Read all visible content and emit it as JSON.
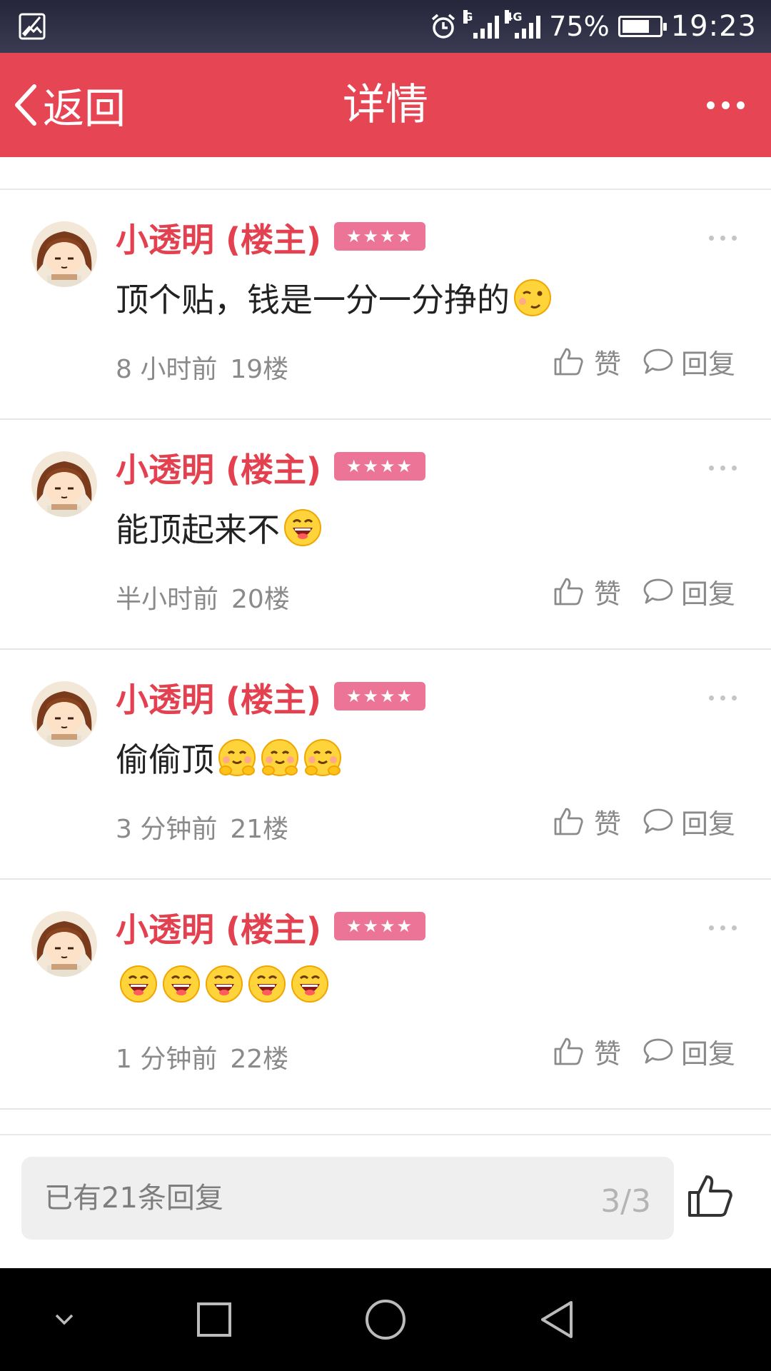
{
  "status_bar": {
    "network_label_1": "G",
    "network_label_2": "4G",
    "battery_percent": "75%",
    "battery_level": 0.75,
    "time": "19:23"
  },
  "header": {
    "back_label": "返回",
    "title": "详情"
  },
  "posts": [
    {
      "username": "小透明 (楼主)",
      "level": "★★★★",
      "text": "顶个贴，钱是一分一分挣的",
      "emojis": [
        "wink-emoji"
      ],
      "time": "8 小时前",
      "floor": "19楼",
      "like_label": "赞",
      "reply_label": "回复"
    },
    {
      "username": "小透明 (楼主)",
      "level": "★★★★",
      "text": "能顶起来不",
      "emojis": [
        "laugh-emoji"
      ],
      "time": "半小时前",
      "floor": "20楼",
      "like_label": "赞",
      "reply_label": "回复"
    },
    {
      "username": "小透明 (楼主)",
      "level": "★★★★",
      "text": "偷偷顶",
      "emojis": [
        "hug-emoji",
        "hug-emoji",
        "hug-emoji"
      ],
      "time": "3 分钟前",
      "floor": "21楼",
      "like_label": "赞",
      "reply_label": "回复"
    },
    {
      "username": "小透明 (楼主)",
      "level": "★★★★",
      "text": "",
      "emojis": [
        "laugh-emoji",
        "laugh-emoji",
        "laugh-emoji",
        "laugh-emoji",
        "laugh-emoji"
      ],
      "time": "1 分钟前",
      "floor": "22楼",
      "like_label": "赞",
      "reply_label": "回复"
    }
  ],
  "reply_bar": {
    "placeholder": "已有21条回复",
    "page_indicator": "3/3"
  },
  "colors": {
    "header_bg": "#e64553",
    "username": "#e3414f",
    "level_badge": "#ec7496",
    "meta_text": "#8a8a8a"
  }
}
